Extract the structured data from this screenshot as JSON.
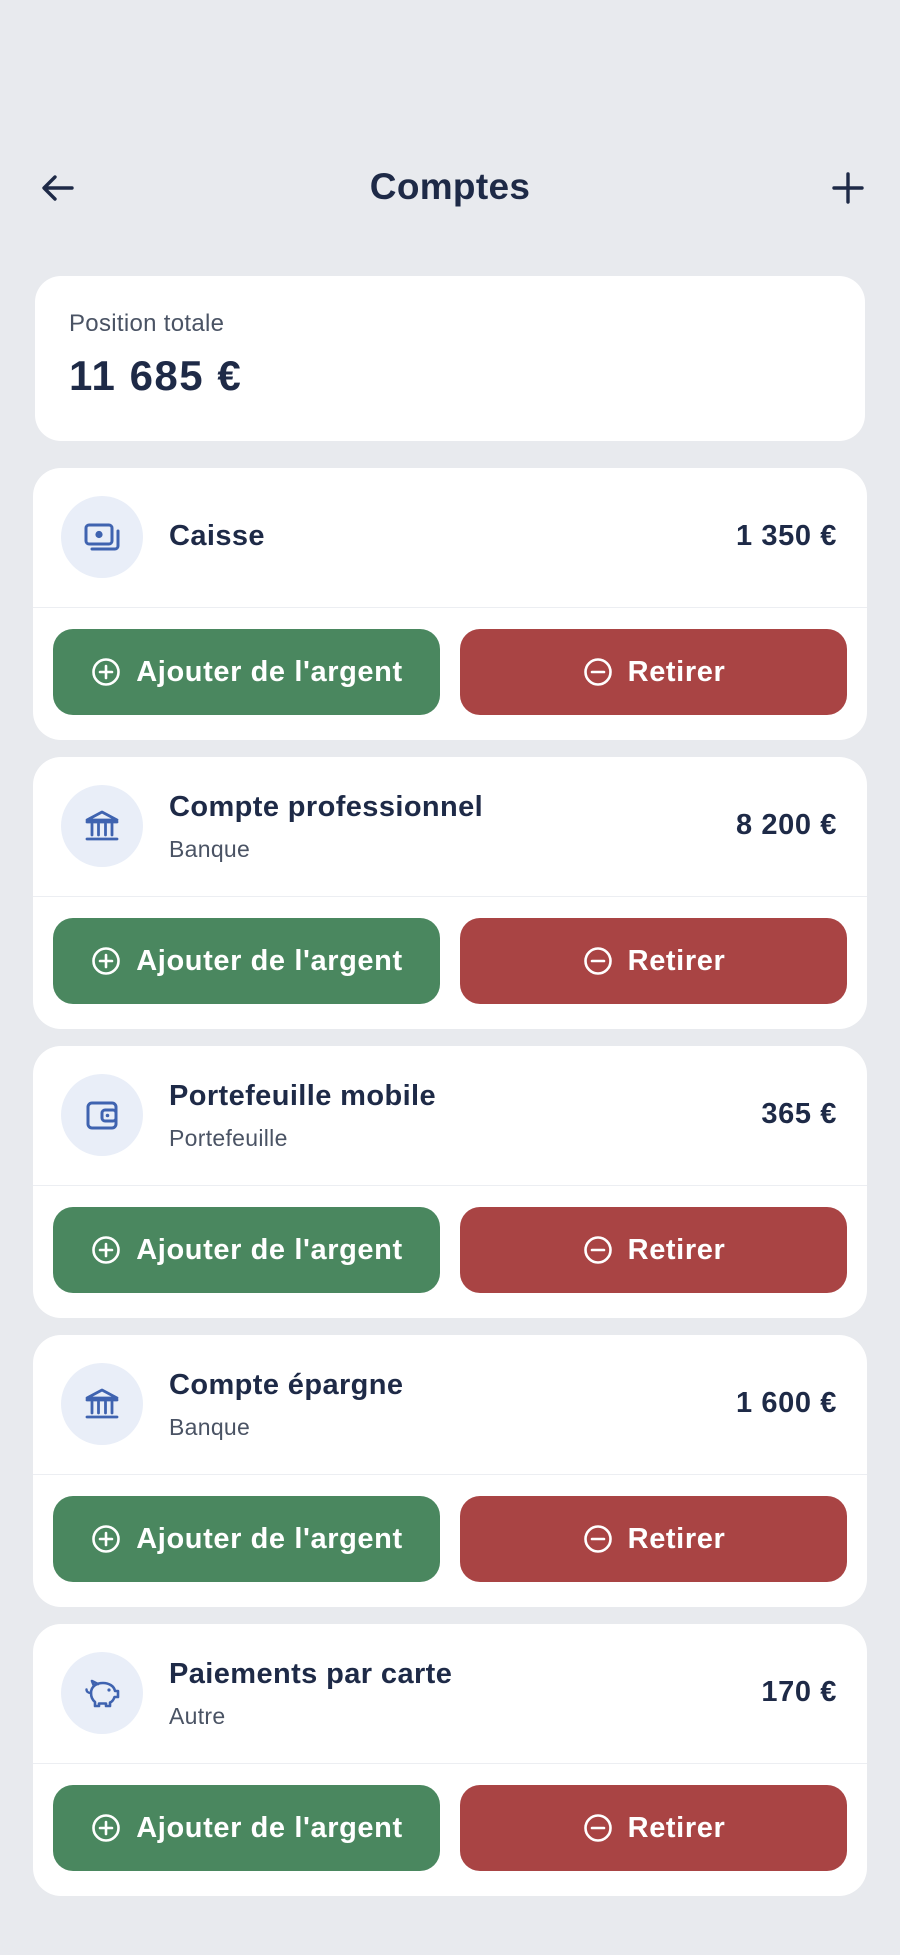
{
  "header": {
    "title": "Comptes"
  },
  "summary": {
    "label": "Position totale",
    "amount": "11 685 €"
  },
  "buttons": {
    "add_label": "Ajouter de l'argent",
    "withdraw_label": "Retirer"
  },
  "accounts": [
    {
      "name": "Caisse",
      "type": "",
      "balance": "1 350 €",
      "icon": "cash-icon"
    },
    {
      "name": "Compte professionnel",
      "type": "Banque",
      "balance": "8 200 €",
      "icon": "bank-icon"
    },
    {
      "name": "Portefeuille mobile",
      "type": "Portefeuille",
      "balance": "365 €",
      "icon": "wallet-icon"
    },
    {
      "name": "Compte épargne",
      "type": "Banque",
      "balance": "1 600 €",
      "icon": "bank-icon"
    },
    {
      "name": "Paiements par carte",
      "type": "Autre",
      "balance": "170 €",
      "icon": "piggy-bank-icon"
    }
  ],
  "colors": {
    "accent_add": "#4a875f",
    "accent_withdraw": "#a94444",
    "icon_blue": "#3f63b0"
  }
}
